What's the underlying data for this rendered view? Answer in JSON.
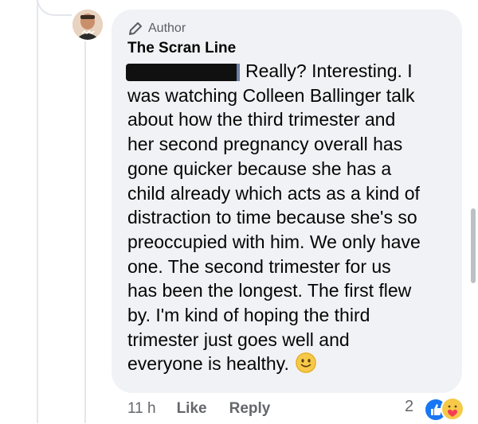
{
  "comment": {
    "badge": "Author",
    "author_name": "The Scran Line",
    "text": "Really? Interesting. I\nwas watching Colleen Ballinger talk\nabout how the third trimester and\nher second pregnancy overall has\ngone quicker because she has a\nchild already which acts as a kind of\ndistraction to time because she's so\npreoccupied with him. We only have\none. The second trimester for us\nhas been the longest. The first flew\nby. I'm kind of hoping the third\ntrimester just goes well and\neveryone is healthy.",
    "emoji_icon": "slightly-smiling-face-icon"
  },
  "actions": {
    "time": "11 h",
    "like_label": "Like",
    "reply_label": "Reply"
  },
  "reactions": {
    "count": "2",
    "icons": [
      "like-icon",
      "care-icon"
    ]
  },
  "colors": {
    "bubble": "#f0f2f5",
    "like_blue": "#1877f2",
    "meta_gray": "#65676b"
  }
}
